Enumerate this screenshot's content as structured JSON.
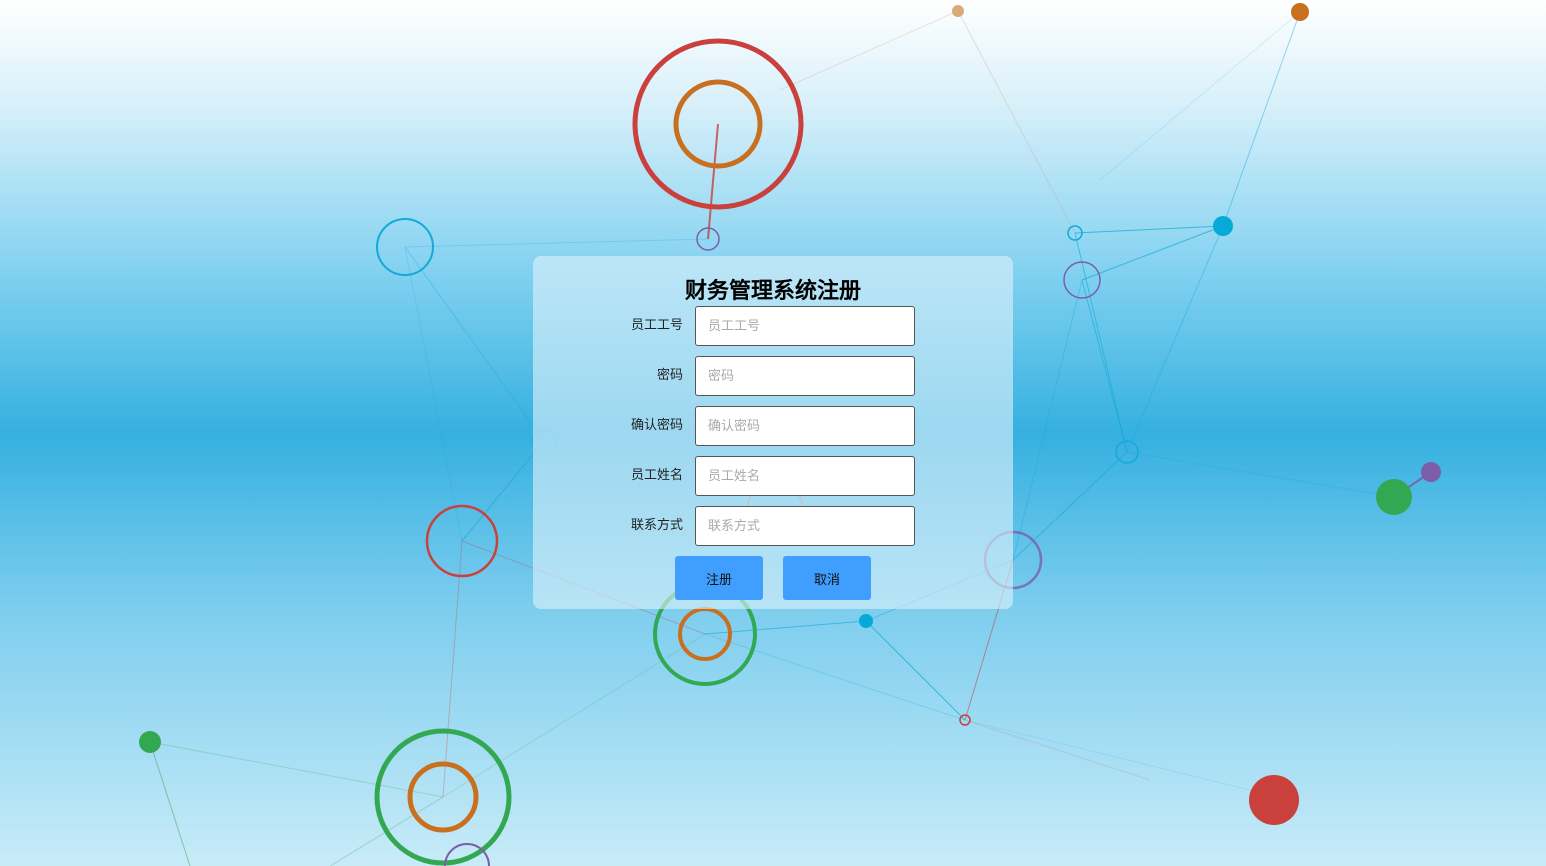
{
  "form": {
    "title": "财务管理系统注册",
    "fields": [
      {
        "label": "员工工号",
        "placeholder": "员工工号",
        "value": ""
      },
      {
        "label": "密码",
        "placeholder": "密码",
        "value": ""
      },
      {
        "label": "确认密码",
        "placeholder": "确认密码",
        "value": ""
      },
      {
        "label": "员工姓名",
        "placeholder": "员工姓名",
        "value": ""
      },
      {
        "label": "联系方式",
        "placeholder": "联系方式",
        "value": ""
      }
    ],
    "register_label": "注册",
    "cancel_label": "取消"
  },
  "colors": {
    "button": "#409eff",
    "circle_red": "#c9403c",
    "circle_orange": "#c87020",
    "circle_green": "#33a852",
    "circle_blue": "#13aad6",
    "circle_purple": "#7b5ea7"
  }
}
